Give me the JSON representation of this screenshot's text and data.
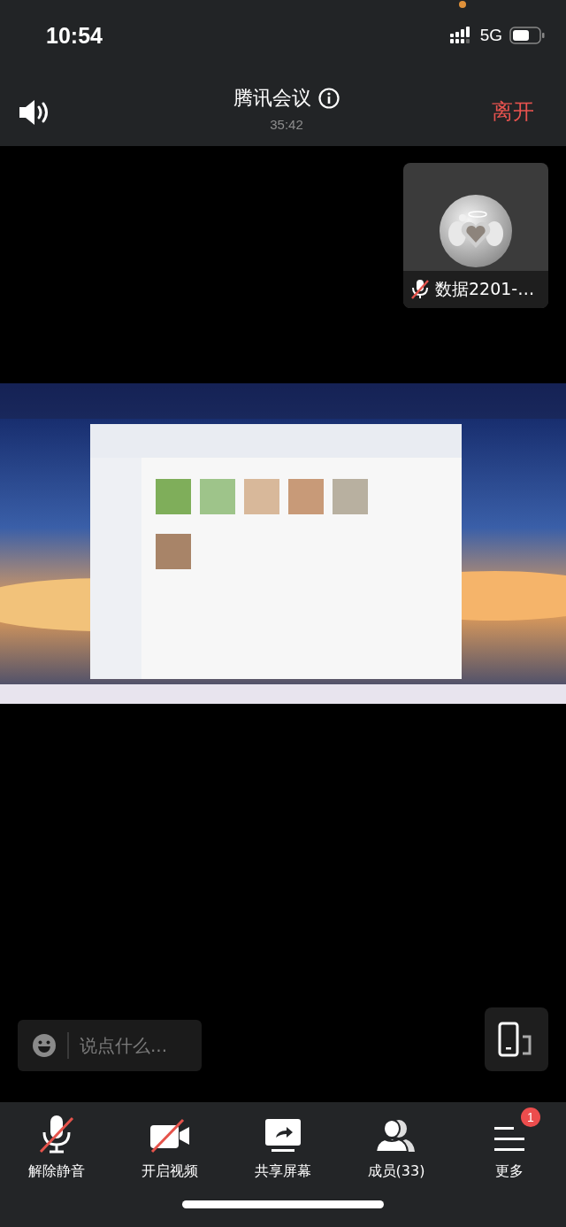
{
  "status_bar": {
    "time": "10:54",
    "network": "5G"
  },
  "header": {
    "title": "腾讯会议",
    "duration": "35:42",
    "leave": "离开"
  },
  "participant": {
    "name": "数据2201-…",
    "muted": true
  },
  "chat": {
    "placeholder": "说点什么..."
  },
  "toolbar": [
    {
      "kind": "mic",
      "label": "解除静音",
      "on": false
    },
    {
      "kind": "camera",
      "label": "开启视频",
      "on": false
    },
    {
      "kind": "share",
      "label": "共享屏幕"
    },
    {
      "kind": "members",
      "label": "成员(33)"
    },
    {
      "kind": "more",
      "label": "更多",
      "badge": "1"
    }
  ]
}
